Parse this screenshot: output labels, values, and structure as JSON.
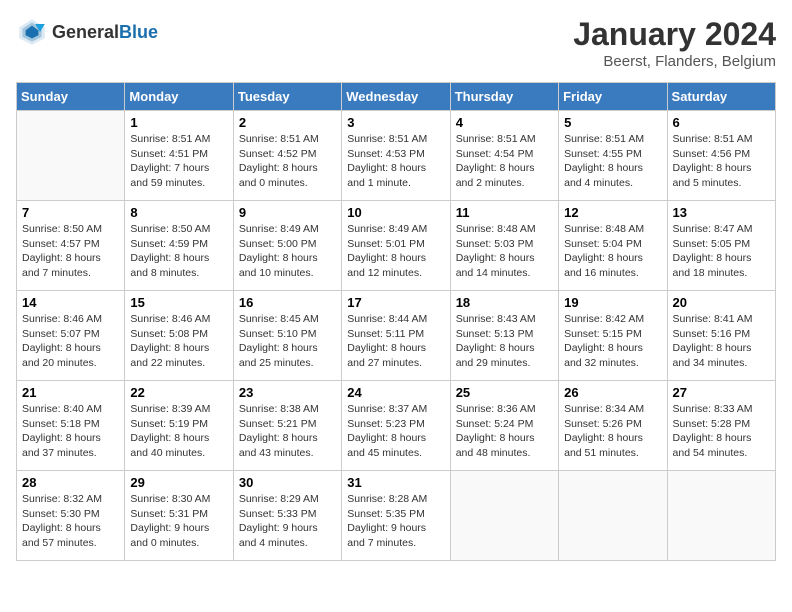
{
  "logo": {
    "general": "General",
    "blue": "Blue"
  },
  "title": "January 2024",
  "subtitle": "Beerst, Flanders, Belgium",
  "days_of_week": [
    "Sunday",
    "Monday",
    "Tuesday",
    "Wednesday",
    "Thursday",
    "Friday",
    "Saturday"
  ],
  "weeks": [
    [
      {
        "num": "",
        "sunrise": "",
        "sunset": "",
        "daylight": ""
      },
      {
        "num": "1",
        "sunrise": "Sunrise: 8:51 AM",
        "sunset": "Sunset: 4:51 PM",
        "daylight": "Daylight: 7 hours and 59 minutes."
      },
      {
        "num": "2",
        "sunrise": "Sunrise: 8:51 AM",
        "sunset": "Sunset: 4:52 PM",
        "daylight": "Daylight: 8 hours and 0 minutes."
      },
      {
        "num": "3",
        "sunrise": "Sunrise: 8:51 AM",
        "sunset": "Sunset: 4:53 PM",
        "daylight": "Daylight: 8 hours and 1 minute."
      },
      {
        "num": "4",
        "sunrise": "Sunrise: 8:51 AM",
        "sunset": "Sunset: 4:54 PM",
        "daylight": "Daylight: 8 hours and 2 minutes."
      },
      {
        "num": "5",
        "sunrise": "Sunrise: 8:51 AM",
        "sunset": "Sunset: 4:55 PM",
        "daylight": "Daylight: 8 hours and 4 minutes."
      },
      {
        "num": "6",
        "sunrise": "Sunrise: 8:51 AM",
        "sunset": "Sunset: 4:56 PM",
        "daylight": "Daylight: 8 hours and 5 minutes."
      }
    ],
    [
      {
        "num": "7",
        "sunrise": "Sunrise: 8:50 AM",
        "sunset": "Sunset: 4:57 PM",
        "daylight": "Daylight: 8 hours and 7 minutes."
      },
      {
        "num": "8",
        "sunrise": "Sunrise: 8:50 AM",
        "sunset": "Sunset: 4:59 PM",
        "daylight": "Daylight: 8 hours and 8 minutes."
      },
      {
        "num": "9",
        "sunrise": "Sunrise: 8:49 AM",
        "sunset": "Sunset: 5:00 PM",
        "daylight": "Daylight: 8 hours and 10 minutes."
      },
      {
        "num": "10",
        "sunrise": "Sunrise: 8:49 AM",
        "sunset": "Sunset: 5:01 PM",
        "daylight": "Daylight: 8 hours and 12 minutes."
      },
      {
        "num": "11",
        "sunrise": "Sunrise: 8:48 AM",
        "sunset": "Sunset: 5:03 PM",
        "daylight": "Daylight: 8 hours and 14 minutes."
      },
      {
        "num": "12",
        "sunrise": "Sunrise: 8:48 AM",
        "sunset": "Sunset: 5:04 PM",
        "daylight": "Daylight: 8 hours and 16 minutes."
      },
      {
        "num": "13",
        "sunrise": "Sunrise: 8:47 AM",
        "sunset": "Sunset: 5:05 PM",
        "daylight": "Daylight: 8 hours and 18 minutes."
      }
    ],
    [
      {
        "num": "14",
        "sunrise": "Sunrise: 8:46 AM",
        "sunset": "Sunset: 5:07 PM",
        "daylight": "Daylight: 8 hours and 20 minutes."
      },
      {
        "num": "15",
        "sunrise": "Sunrise: 8:46 AM",
        "sunset": "Sunset: 5:08 PM",
        "daylight": "Daylight: 8 hours and 22 minutes."
      },
      {
        "num": "16",
        "sunrise": "Sunrise: 8:45 AM",
        "sunset": "Sunset: 5:10 PM",
        "daylight": "Daylight: 8 hours and 25 minutes."
      },
      {
        "num": "17",
        "sunrise": "Sunrise: 8:44 AM",
        "sunset": "Sunset: 5:11 PM",
        "daylight": "Daylight: 8 hours and 27 minutes."
      },
      {
        "num": "18",
        "sunrise": "Sunrise: 8:43 AM",
        "sunset": "Sunset: 5:13 PM",
        "daylight": "Daylight: 8 hours and 29 minutes."
      },
      {
        "num": "19",
        "sunrise": "Sunrise: 8:42 AM",
        "sunset": "Sunset: 5:15 PM",
        "daylight": "Daylight: 8 hours and 32 minutes."
      },
      {
        "num": "20",
        "sunrise": "Sunrise: 8:41 AM",
        "sunset": "Sunset: 5:16 PM",
        "daylight": "Daylight: 8 hours and 34 minutes."
      }
    ],
    [
      {
        "num": "21",
        "sunrise": "Sunrise: 8:40 AM",
        "sunset": "Sunset: 5:18 PM",
        "daylight": "Daylight: 8 hours and 37 minutes."
      },
      {
        "num": "22",
        "sunrise": "Sunrise: 8:39 AM",
        "sunset": "Sunset: 5:19 PM",
        "daylight": "Daylight: 8 hours and 40 minutes."
      },
      {
        "num": "23",
        "sunrise": "Sunrise: 8:38 AM",
        "sunset": "Sunset: 5:21 PM",
        "daylight": "Daylight: 8 hours and 43 minutes."
      },
      {
        "num": "24",
        "sunrise": "Sunrise: 8:37 AM",
        "sunset": "Sunset: 5:23 PM",
        "daylight": "Daylight: 8 hours and 45 minutes."
      },
      {
        "num": "25",
        "sunrise": "Sunrise: 8:36 AM",
        "sunset": "Sunset: 5:24 PM",
        "daylight": "Daylight: 8 hours and 48 minutes."
      },
      {
        "num": "26",
        "sunrise": "Sunrise: 8:34 AM",
        "sunset": "Sunset: 5:26 PM",
        "daylight": "Daylight: 8 hours and 51 minutes."
      },
      {
        "num": "27",
        "sunrise": "Sunrise: 8:33 AM",
        "sunset": "Sunset: 5:28 PM",
        "daylight": "Daylight: 8 hours and 54 minutes."
      }
    ],
    [
      {
        "num": "28",
        "sunrise": "Sunrise: 8:32 AM",
        "sunset": "Sunset: 5:30 PM",
        "daylight": "Daylight: 8 hours and 57 minutes."
      },
      {
        "num": "29",
        "sunrise": "Sunrise: 8:30 AM",
        "sunset": "Sunset: 5:31 PM",
        "daylight": "Daylight: 9 hours and 0 minutes."
      },
      {
        "num": "30",
        "sunrise": "Sunrise: 8:29 AM",
        "sunset": "Sunset: 5:33 PM",
        "daylight": "Daylight: 9 hours and 4 minutes."
      },
      {
        "num": "31",
        "sunrise": "Sunrise: 8:28 AM",
        "sunset": "Sunset: 5:35 PM",
        "daylight": "Daylight: 9 hours and 7 minutes."
      },
      {
        "num": "",
        "sunrise": "",
        "sunset": "",
        "daylight": ""
      },
      {
        "num": "",
        "sunrise": "",
        "sunset": "",
        "daylight": ""
      },
      {
        "num": "",
        "sunrise": "",
        "sunset": "",
        "daylight": ""
      }
    ]
  ]
}
